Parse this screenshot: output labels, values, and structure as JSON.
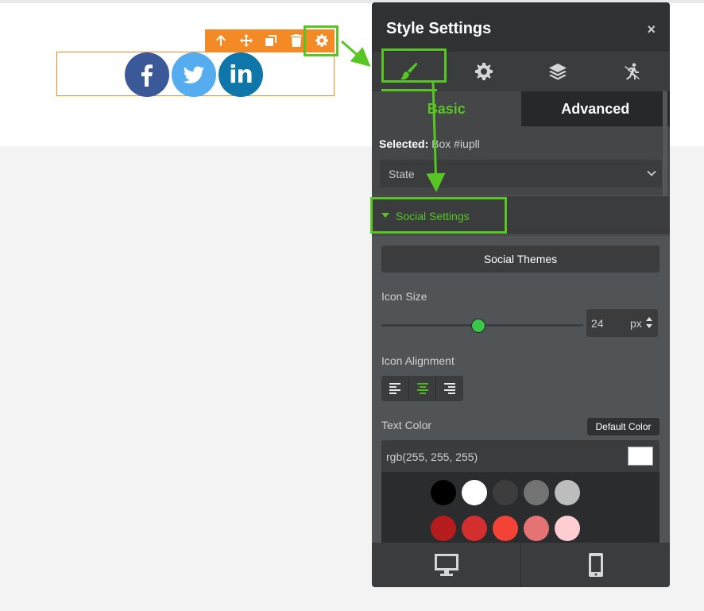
{
  "colors": {
    "accent": "#57c623",
    "toolbar": "#f48a26",
    "panel_bg": "#444648",
    "facebook": "#3b5998",
    "twitter": "#55acee",
    "linkedin": "#0e76a8"
  },
  "element_toolbar": {
    "buttons": [
      "arrow-up-icon",
      "move-icon",
      "clone-icon",
      "trash-icon",
      "gear-icon"
    ]
  },
  "social_widget": {
    "items": [
      {
        "network": "facebook",
        "icon": "facebook-icon"
      },
      {
        "network": "twitter",
        "icon": "twitter-icon"
      },
      {
        "network": "linkedin",
        "icon": "linkedin-icon",
        "glyph": "in"
      }
    ]
  },
  "panel": {
    "title": "Style Settings",
    "close_label": "×",
    "icon_tabs": [
      "paint-brush-icon",
      "gear-icon",
      "layers-icon",
      "accessibility-icon"
    ],
    "active_icon_tab": "paint-brush-icon",
    "sub_tabs": {
      "basic": "Basic",
      "advanced": "Advanced",
      "active": "Basic"
    },
    "selected": {
      "prefix": "Selected:",
      "name": "Box",
      "id": "#iupll"
    },
    "state_select": {
      "value": "State"
    },
    "section": {
      "title": "Social Settings",
      "themes_button": "Social Themes",
      "icon_size": {
        "label": "Icon Size",
        "value": "24",
        "unit": "px",
        "slider_fraction": 0.48
      },
      "icon_alignment": {
        "label": "Icon Alignment",
        "options": [
          "align-left-icon",
          "align-center-icon",
          "align-right-icon"
        ],
        "selected": "align-center-icon"
      },
      "text_color": {
        "label": "Text Color",
        "default_button": "Default Color",
        "value": "rgb(255, 255, 255)",
        "swatch_rows": [
          [
            "#000000",
            "#ffffff",
            "#3d3d3d",
            "#737373",
            "#bdbdbd"
          ],
          [
            "#b71c1c",
            "#d32f2f",
            "#f44336",
            "#e57373",
            "#ffcdd2"
          ]
        ]
      }
    },
    "footer": [
      "desktop-icon",
      "mobile-icon"
    ]
  }
}
